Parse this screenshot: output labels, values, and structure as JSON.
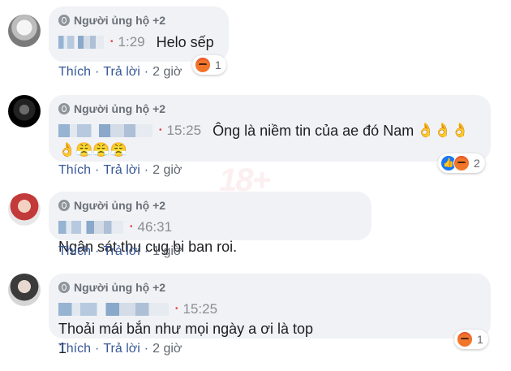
{
  "badge_label": "Người ủng hộ +2",
  "actions": {
    "like": "Thích",
    "reply": "Trả lời"
  },
  "comments": [
    {
      "time": "1:29",
      "text": "Helo sếp",
      "emoji": "",
      "age": "2 giờ",
      "reaction_count": "1"
    },
    {
      "time": "15:25",
      "text": "Ông là niềm tin của ae đó Nam",
      "emoji_line1": "👌👌👌",
      "emoji_line2": "👌😤😤😤",
      "age": "2 giờ",
      "reaction_count": "2"
    },
    {
      "time": "46:31",
      "text": "Ngân sát thu cug bi ban roi.",
      "age": "1 giờ"
    },
    {
      "time": "15:25",
      "text_line1": "Thoải mái bắn như mọi ngày a ơi là top",
      "text_line2": "1",
      "age": "2 giờ",
      "reaction_count": "1"
    }
  ]
}
